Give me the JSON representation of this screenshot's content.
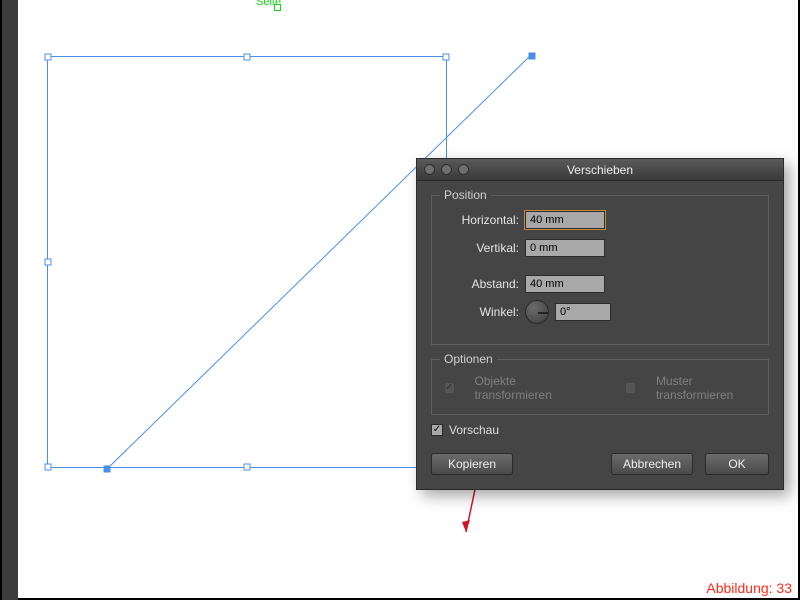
{
  "canvas": {
    "page_label": "Seite"
  },
  "dialog": {
    "title": "Verschieben",
    "position": {
      "legend": "Position",
      "horizontal_label": "Horizontal:",
      "horizontal_value": "40 mm",
      "vertical_label": "Vertikal:",
      "vertical_value": "0 mm",
      "distance_label": "Abstand:",
      "distance_value": "40 mm",
      "angle_label": "Winkel:",
      "angle_value": "0°"
    },
    "options": {
      "legend": "Optionen",
      "transform_objects_label": "Objekte transformieren",
      "transform_objects_checked": true,
      "transform_pattern_label": "Muster transformieren",
      "transform_pattern_checked": false
    },
    "preview_label": "Vorschau",
    "preview_checked": true,
    "buttons": {
      "copy": "Kopieren",
      "cancel": "Abbrechen",
      "ok": "OK"
    }
  },
  "caption": "Abbildung: 33"
}
